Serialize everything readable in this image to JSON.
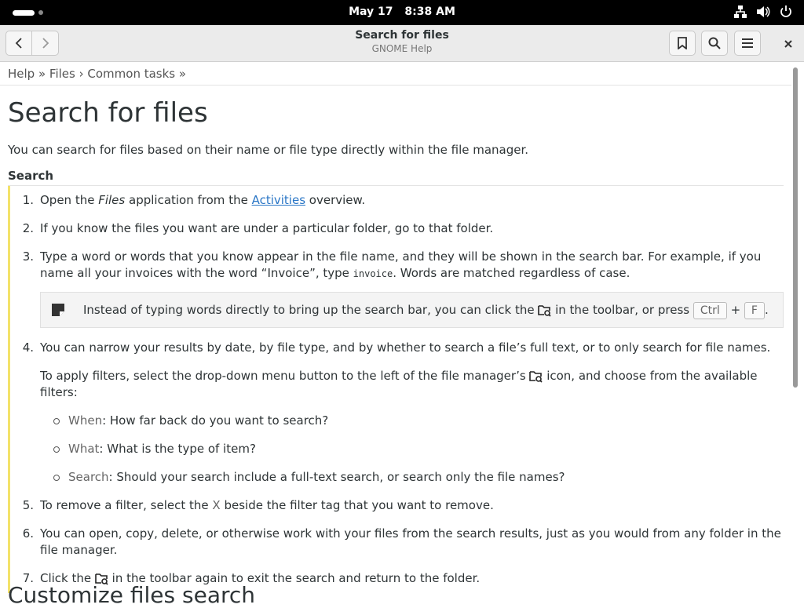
{
  "topbar": {
    "date": "May 17",
    "time": "8:38 AM"
  },
  "window": {
    "title": "Search for files",
    "subtitle": "GNOME Help"
  },
  "breadcrumb": {
    "help": "Help",
    "sep1": " » ",
    "files": "Files",
    "sep2": " › ",
    "common": "Common tasks",
    "sep3": " »"
  },
  "page": {
    "heading": "Search for files",
    "intro": "You can search for files based on their name or file type directly within the file manager.",
    "section": "Search",
    "steps": {
      "s1": {
        "num": "1.",
        "a": "Open the ",
        "em": "Files",
        "b": " application from the ",
        "link": "Activities",
        "c": " overview."
      },
      "s2": {
        "num": "2.",
        "text": "If you know the files you want are under a particular folder, go to that folder."
      },
      "s3": {
        "num": "3.",
        "a": "Type a word or words that you know appear in the file name, and they will be shown in the search bar. For example, if you name all your invoices with the word “Invoice”, type ",
        "code": "invoice",
        "b": ". Words are matched regardless of case."
      },
      "note": {
        "a": "Instead of typing words directly to bring up the search bar, you can click the ",
        "b": " in the toolbar, or press ",
        "key1": "Ctrl",
        "plus": "+",
        "key2": "F",
        "c": "."
      },
      "s4": {
        "num": "4.",
        "text": "You can narrow your results by date, by file type, and by whether to search a file’s full text, or to only search for file names.",
        "p2a": "To apply filters, select the drop-down menu button to the left of the file manager’s ",
        "p2b": " icon, and choose from the available filters:",
        "filters": [
          {
            "label": "When",
            "text": ": How far back do you want to search?"
          },
          {
            "label": "What",
            "text": ": What is the type of item?"
          },
          {
            "label": "Search",
            "text": ": Should your search include a full-text search, or search only the file names?"
          }
        ]
      },
      "s5": {
        "num": "5.",
        "a": "To remove a filter, select the ",
        "x": "X",
        "b": " beside the filter tag that you want to remove."
      },
      "s6": {
        "num": "6.",
        "text": "You can open, copy, delete, or otherwise work with your files from the search results, just as you would from any folder in the file manager."
      },
      "s7": {
        "num": "7.",
        "a": "Click the ",
        "b": " in the toolbar again to exit the search and return to the folder."
      }
    },
    "next_heading": "Customize files search"
  },
  "icons": {
    "back": "go-back-icon",
    "forward": "go-forward-icon",
    "bookmark": "bookmark-icon",
    "search": "search-icon",
    "menu": "hamburger-menu-icon",
    "close": "close-icon",
    "note": "note-icon",
    "folder_search": "folder-search-icon",
    "network": "network-icon",
    "volume": "volume-icon",
    "power": "power-icon"
  },
  "colors": {
    "link": "#2a76c6",
    "steps_border": "#f3e26a",
    "topbar": "#000000",
    "header": "#ebebeb"
  }
}
